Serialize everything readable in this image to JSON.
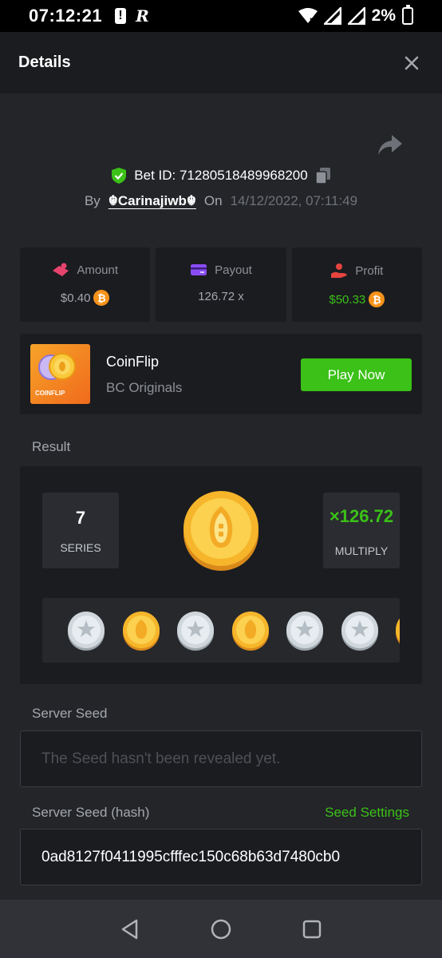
{
  "status_bar": {
    "time": "07:12:21",
    "battery": "2%"
  },
  "header": {
    "title": "Details"
  },
  "bet": {
    "id_label": "Bet ID: 712805184899682​00",
    "by_label": "By",
    "user": "☬Carinajiwb☬",
    "on_label": "On",
    "datetime": "14/12/2022, 07:11:49"
  },
  "stats": {
    "amount": {
      "label": "Amount",
      "value": "$0.40"
    },
    "payout": {
      "label": "Payout",
      "value": "126.72 x"
    },
    "profit": {
      "label": "Profit",
      "value": "$50.33"
    }
  },
  "game": {
    "name": "CoinFlip",
    "provider": "BC Originals",
    "thumb_label": "COINFLIP",
    "play_label": "Play Now"
  },
  "result": {
    "section_label": "Result",
    "series_value": "7",
    "series_label": "SERIES",
    "multiply_value": "×126.72",
    "multiply_label": "MULTIPLY",
    "history": [
      "silver",
      "gold",
      "silver",
      "gold",
      "silver",
      "silver",
      "gold"
    ]
  },
  "server_seed": {
    "label": "Server Seed",
    "placeholder": "The Seed hasn't been revealed yet."
  },
  "server_seed_hash": {
    "label": "Server Seed (hash)",
    "settings_label": "Seed Settings",
    "value": "0ad8127f0411995cfffec150c68b63d7480cb0"
  },
  "colors": {
    "accent_green": "#3bc117",
    "bitcoin": "#f7931a",
    "background": "#232529",
    "card": "#1b1c20"
  }
}
